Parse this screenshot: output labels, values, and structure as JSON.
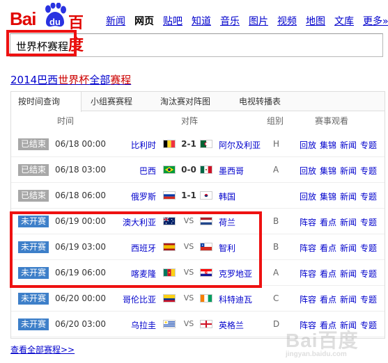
{
  "logo": {
    "left_text": "Bai",
    "paw_text": "du",
    "right_text": "百度"
  },
  "nav": [
    "新闻",
    "网页",
    "贴吧",
    "知道",
    "音乐",
    "图片",
    "视频",
    "地图",
    "文库",
    "更多»"
  ],
  "search": {
    "query": "世界杯赛程"
  },
  "result": {
    "title_prefix": "2014巴西",
    "title_em1": "世界杯",
    "title_mid": "全部",
    "title_em2": "赛程"
  },
  "tabs": [
    "按时间查询",
    "小组赛赛程",
    "淘汰赛对阵图",
    "电视转播表"
  ],
  "columns": {
    "time": "时间",
    "match": "对阵",
    "group": "组别",
    "watch": "赛事观看"
  },
  "matches": [
    {
      "status": "已结束",
      "time": "06/18 00:00",
      "home": "比利时",
      "score": "2-1",
      "away": "阿尔及利亚",
      "group": "H",
      "links": [
        "回放",
        "集锦",
        "新闻",
        "专题"
      ]
    },
    {
      "status": "已结束",
      "time": "06/18 03:00",
      "home": "巴西",
      "score": "0-0",
      "away": "墨西哥",
      "group": "A",
      "links": [
        "回放",
        "集锦",
        "新闻",
        "专题"
      ]
    },
    {
      "status": "已结束",
      "time": "06/18 06:00",
      "home": "俄罗斯",
      "score": "1-1",
      "away": "韩国",
      "group": "",
      "links": [
        "回放",
        "集锦",
        "新闻",
        "专题"
      ]
    },
    {
      "status": "未开赛",
      "time": "06/19 00:00",
      "home": "澳大利亚",
      "score": "VS",
      "away": "荷兰",
      "group": "B",
      "links": [
        "阵容",
        "看点",
        "新闻",
        "专题"
      ]
    },
    {
      "status": "未开赛",
      "time": "06/19 03:00",
      "home": "西班牙",
      "score": "VS",
      "away": "智利",
      "group": "B",
      "links": [
        "阵容",
        "看点",
        "新闻",
        "专题"
      ]
    },
    {
      "status": "未开赛",
      "time": "06/19 06:00",
      "home": "喀麦隆",
      "score": "VS",
      "away": "克罗地亚",
      "group": "A",
      "links": [
        "阵容",
        "看点",
        "新闻",
        "专题"
      ]
    },
    {
      "status": "未开赛",
      "time": "06/20 00:00",
      "home": "哥伦比亚",
      "score": "VS",
      "away": "科特迪瓦",
      "group": "C",
      "links": [
        "阵容",
        "看点",
        "新闻",
        "专题"
      ]
    },
    {
      "status": "未开赛",
      "time": "06/20 03:00",
      "home": "乌拉圭",
      "score": "VS",
      "away": "英格兰",
      "group": "D",
      "links": [
        "阵容",
        "看点",
        "新闻",
        "专题"
      ]
    }
  ],
  "footer": {
    "view_all": "查看全部赛程>>"
  },
  "watermark": {
    "text": "Bai百度",
    "sub": "jingyan.baidu.com"
  },
  "colors": {
    "brand_red": "#e10602",
    "link_blue": "#0000cc",
    "badge_done": "#a8a8a8",
    "badge_todo": "#3d7fc9",
    "highlight": "#ee1111"
  },
  "flags": [
    [
      "belgium-flag-icon",
      "algeria-flag-icon"
    ],
    [
      "brazil-flag-icon",
      "mexico-flag-icon"
    ],
    [
      "russia-flag-icon",
      "korea-flag-icon"
    ],
    [
      "australia-flag-icon",
      "netherlands-flag-icon"
    ],
    [
      "spain-flag-icon",
      "chile-flag-icon"
    ],
    [
      "cameroon-flag-icon",
      "croatia-flag-icon"
    ],
    [
      "colombia-flag-icon",
      "ivory-coast-flag-icon"
    ],
    [
      "uruguay-flag-icon",
      "england-flag-icon"
    ]
  ]
}
